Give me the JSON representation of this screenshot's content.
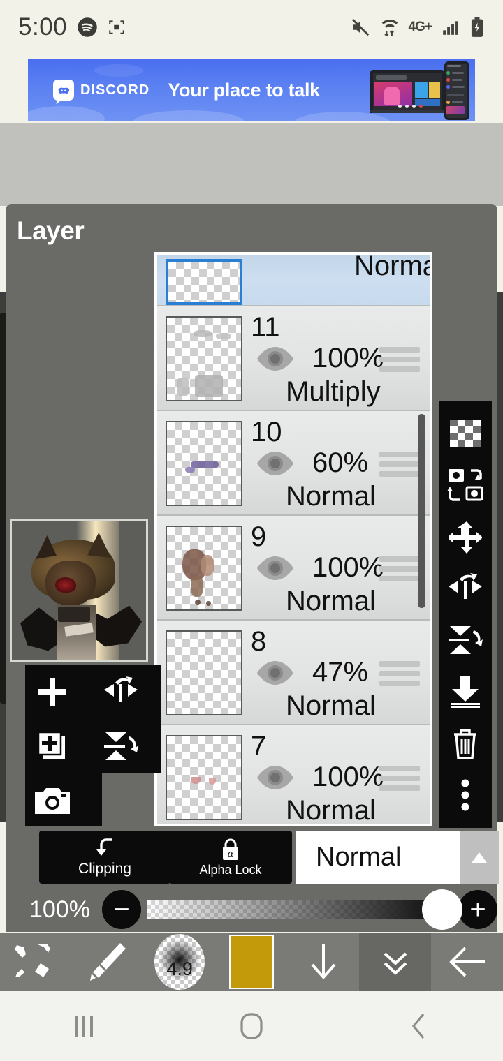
{
  "status_bar": {
    "time": "5:00",
    "left_icons": [
      "spotify-icon",
      "screen-record-icon"
    ],
    "right_icons": [
      "mute-icon",
      "wifi-data-icon",
      "network-4g-plus-icon",
      "signal-bars-icon",
      "battery-charging-icon"
    ],
    "network_label": "4G+",
    "background_color": "#f2f2e8"
  },
  "ad": {
    "brand": "DISCORD",
    "tagline": "Your place to talk",
    "background_color": "#5b81f2"
  },
  "panel": {
    "title": "Layer",
    "background_color": "#6a6a67"
  },
  "layers": [
    {
      "name": "",
      "opacity": "",
      "blend": "Normal",
      "selected": true,
      "partial": true
    },
    {
      "name": "11",
      "opacity": "100%",
      "blend": "Multiply",
      "selected": false,
      "partial": false
    },
    {
      "name": "10",
      "opacity": "60%",
      "blend": "Normal",
      "selected": false,
      "partial": false
    },
    {
      "name": "9",
      "opacity": "100%",
      "blend": "Normal",
      "selected": false,
      "partial": false
    },
    {
      "name": "8",
      "opacity": "47%",
      "blend": "Normal",
      "selected": false,
      "partial": false
    },
    {
      "name": "7",
      "opacity": "100%",
      "blend": "Normal",
      "selected": false,
      "partial": false
    }
  ],
  "right_toolbar": {
    "items": [
      {
        "icon": "transparency-checker-icon"
      },
      {
        "icon": "swap-layers-icon"
      },
      {
        "icon": "move-layer-icon"
      },
      {
        "icon": "flip-horizontal-icon"
      },
      {
        "icon": "flip-vertical-icon"
      },
      {
        "icon": "merge-down-icon"
      },
      {
        "icon": "delete-layer-icon"
      },
      {
        "icon": "more-options-icon"
      }
    ]
  },
  "left_toolbar": {
    "items": [
      {
        "icon": "add-layer-icon"
      },
      {
        "icon": "flip-horizontal-icon"
      },
      {
        "icon": "duplicate-layer-icon"
      },
      {
        "icon": "flip-vertical-icon"
      },
      {
        "icon": "camera-import-icon"
      }
    ]
  },
  "mode_bar": {
    "clipping_label": "Clipping",
    "alpha_lock_label": "Alpha Lock",
    "alpha_symbol": "α",
    "blend_mode": "Normal"
  },
  "opacity": {
    "value": "100%",
    "minus": "−",
    "plus": "+"
  },
  "bottom_toolbar": {
    "brush_size": "4.9",
    "color_hex": "#c29a0a",
    "items": [
      {
        "icon": "brush-eraser-swap-icon"
      },
      {
        "icon": "brush-icon"
      },
      {
        "icon": "brush-size-icon"
      },
      {
        "icon": "color-swatch-icon"
      },
      {
        "icon": "download-arrow-icon"
      },
      {
        "icon": "chevron-double-down-icon"
      },
      {
        "icon": "back-arrow-icon"
      }
    ]
  },
  "nav_bar": {
    "items": [
      {
        "icon": "recents-icon"
      },
      {
        "icon": "home-icon"
      },
      {
        "icon": "back-icon"
      }
    ]
  }
}
